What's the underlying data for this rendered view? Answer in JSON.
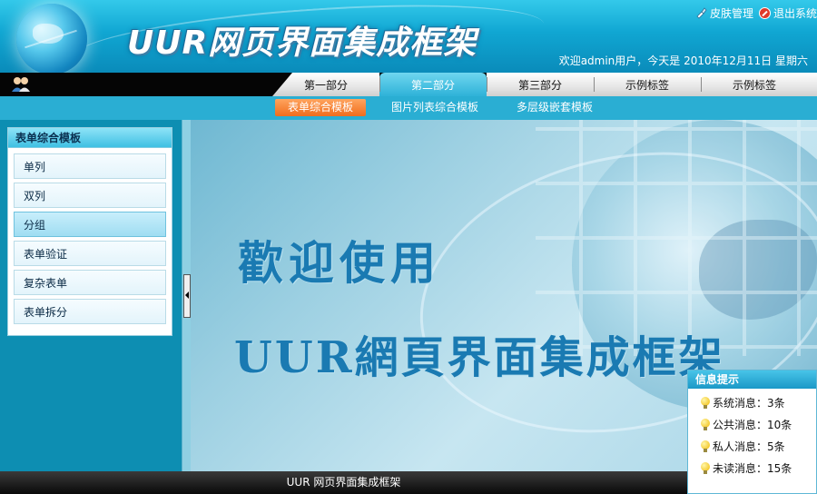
{
  "header": {
    "title": "UUR网页界面集成框架",
    "skin_label": "皮肤管理",
    "exit_label": "退出系统",
    "welcome_text": "欢迎admin用户，今天是 2010年12月11日 星期六"
  },
  "nav": {
    "tabs": [
      {
        "label": "第一部分",
        "active": false
      },
      {
        "label": "第二部分",
        "active": true
      },
      {
        "label": "第三部分",
        "active": false
      },
      {
        "label": "示例标签",
        "active": false
      },
      {
        "label": "示例标签",
        "active": false
      }
    ]
  },
  "subnav": {
    "items": [
      {
        "label": "表单综合模板",
        "active": true
      },
      {
        "label": "图片列表综合模板",
        "active": false
      },
      {
        "label": "多层级嵌套模板",
        "active": false
      }
    ]
  },
  "sidebar": {
    "title": "表单综合模板",
    "items": [
      {
        "label": "单列",
        "active": false
      },
      {
        "label": "双列",
        "active": false
      },
      {
        "label": "分组",
        "active": true
      },
      {
        "label": "表单验证",
        "active": false
      },
      {
        "label": "复杂表单",
        "active": false
      },
      {
        "label": "表单拆分",
        "active": false
      }
    ]
  },
  "main": {
    "welcome_line1": "歡迎使用",
    "welcome_line2": "UUR網頁界面集成框架"
  },
  "info": {
    "title": "信息提示",
    "items": [
      {
        "label": "系统消息：3条"
      },
      {
        "label": "公共消息：10条"
      },
      {
        "label": "私人消息：5条"
      },
      {
        "label": "未读消息：15条"
      }
    ]
  },
  "footer": {
    "text": "UUR 网页界面集成框架"
  },
  "colors": {
    "header_blue": "#10a6d2",
    "active_orange": "#f06d1d",
    "active_tab": "#2eb2d8",
    "footer_black": "#0a0a0a"
  }
}
